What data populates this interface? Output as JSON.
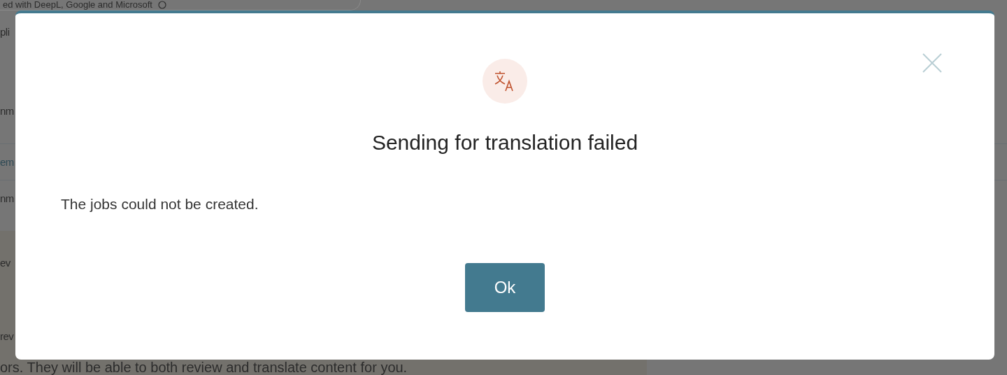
{
  "background": {
    "field_text": "ed with DeepL, Google and Microsoft",
    "rows": [
      {
        "text": "pli",
        "kind": "text"
      },
      {
        "text": "nm",
        "kind": "text"
      },
      {
        "text": "em",
        "kind": "link"
      },
      {
        "text": "nm",
        "kind": "text"
      }
    ],
    "panel_rows": [
      {
        "text": "ev"
      },
      {
        "text": "rev"
      }
    ],
    "notice": "ors. They will be able to both review and translate content for you."
  },
  "dialog": {
    "title": "Sending for translation failed",
    "message": "The jobs could not be created.",
    "button": "Ok"
  }
}
